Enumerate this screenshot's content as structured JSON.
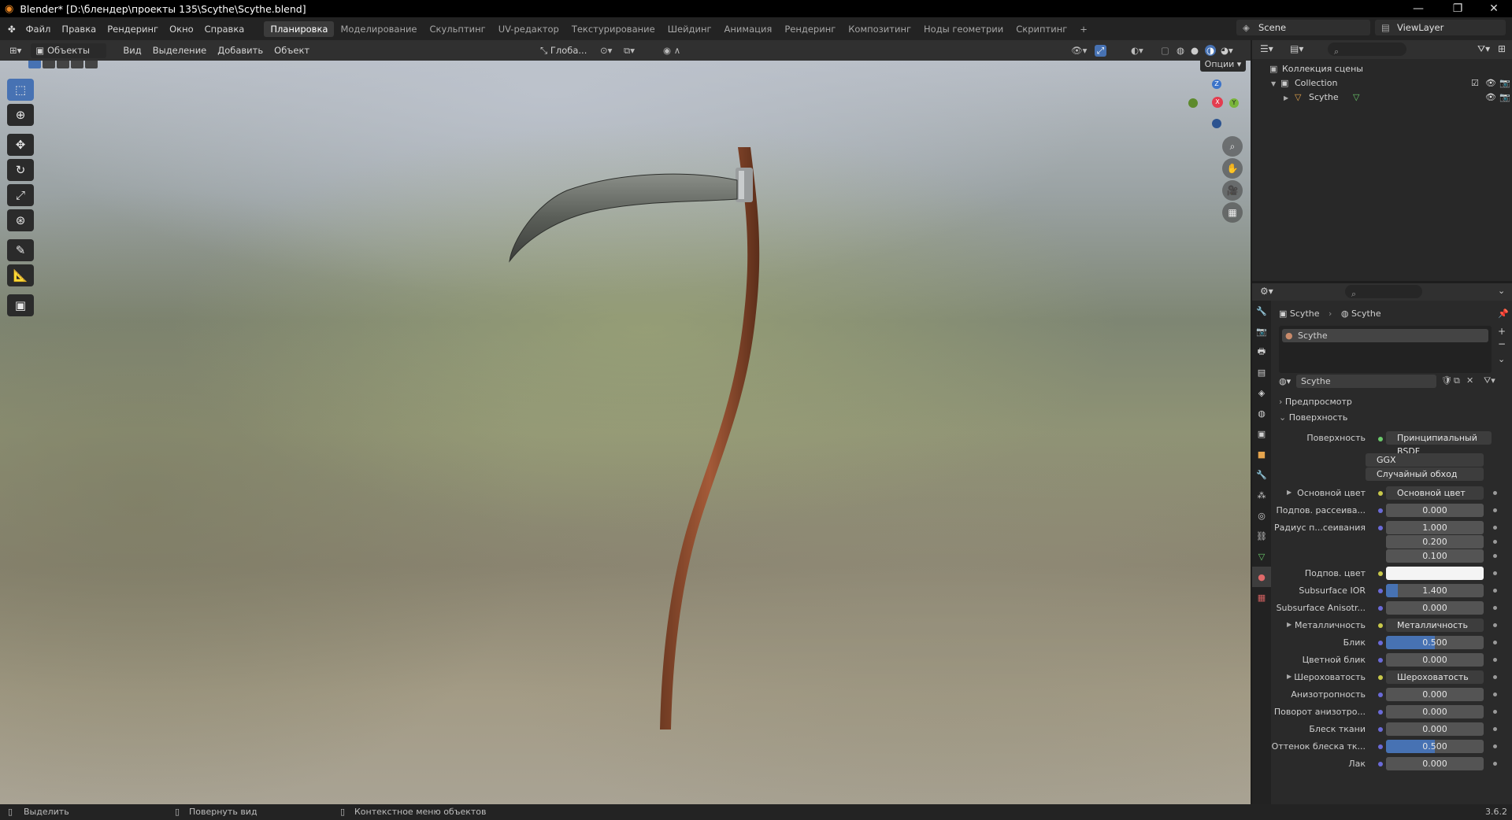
{
  "titlebar": {
    "title": "Blender* [D:\\блендер\\проекты 135\\Scythe\\Scythe.blend]",
    "minimize": "—",
    "maximize": "❐",
    "close": "✕"
  },
  "menu": [
    "Файл",
    "Правка",
    "Рендеринг",
    "Окно",
    "Справка"
  ],
  "workspaces": [
    "Планировка",
    "Моделирование",
    "Скульптинг",
    "UV-редактор",
    "Текстурирование",
    "Шейдинг",
    "Анимация",
    "Рендеринг",
    "Композитинг",
    "Ноды геометрии",
    "Скриптинг",
    "+"
  ],
  "scene": {
    "name": "Scene",
    "view_layer": "ViewLayer"
  },
  "viewport_header": {
    "mode": "Объекты",
    "menus": [
      "Вид",
      "Выделение",
      "Добавить",
      "Объект"
    ],
    "orientation": "Глоба...",
    "options": "Опции"
  },
  "gizmo": {
    "z": "Z",
    "x": "X",
    "y": "Y"
  },
  "outliner": {
    "scene_collection": "Коллекция сцены",
    "collection": "Collection",
    "object": "Scythe"
  },
  "properties": {
    "breadcrumb_object": "Scythe",
    "breadcrumb_material": "Scythe",
    "slot": "Scythe",
    "material_name": "Scythe",
    "panel_preview": "Предпросмотр",
    "panel_surface": "Поверхность",
    "surface_label": "Поверхность",
    "surface_value": "Принципиальный BSDF",
    "distribution": "GGX",
    "subsurface_method": "Случайный обход",
    "rows": [
      {
        "label": "Основной цвет",
        "value": "Основной цвет",
        "type": "link",
        "expand": true
      },
      {
        "label": "Подпов. рассеива...",
        "value": "0.000",
        "type": "num"
      },
      {
        "label": "Радиус п...сеивания",
        "value": "1.000",
        "type": "num"
      },
      {
        "label": "",
        "value": "0.200",
        "type": "num"
      },
      {
        "label": "",
        "value": "0.100",
        "type": "num"
      },
      {
        "label": "Подпов. цвет",
        "value": "",
        "type": "color"
      },
      {
        "label": "Subsurface IOR",
        "value": "1.400",
        "type": "num",
        "fill": 0.12
      },
      {
        "label": "Subsurface Anisotr...",
        "value": "0.000",
        "type": "num"
      },
      {
        "label": "Металличность",
        "value": "Металличность",
        "type": "link",
        "expand": true
      },
      {
        "label": "Блик",
        "value": "0.500",
        "type": "num",
        "fill": 0.5
      },
      {
        "label": "Цветной блик",
        "value": "0.000",
        "type": "num"
      },
      {
        "label": "Шероховатость",
        "value": "Шероховатость",
        "type": "link",
        "expand": true
      },
      {
        "label": "Анизотропность",
        "value": "0.000",
        "type": "num"
      },
      {
        "label": "Поворот анизотро...",
        "value": "0.000",
        "type": "num"
      },
      {
        "label": "Блеск ткани",
        "value": "0.000",
        "type": "num"
      },
      {
        "label": "Оттенок блеска тк...",
        "value": "0.500",
        "type": "num",
        "fill": 0.5
      },
      {
        "label": "Лак",
        "value": "0.000",
        "type": "num"
      }
    ]
  },
  "status": {
    "select": "Выделить",
    "rotate": "Повернуть вид",
    "context": "Контекстное меню объектов",
    "version": "3.6.2"
  },
  "colors": {
    "accent": "#4772b3",
    "select_active": "#4772b3"
  }
}
